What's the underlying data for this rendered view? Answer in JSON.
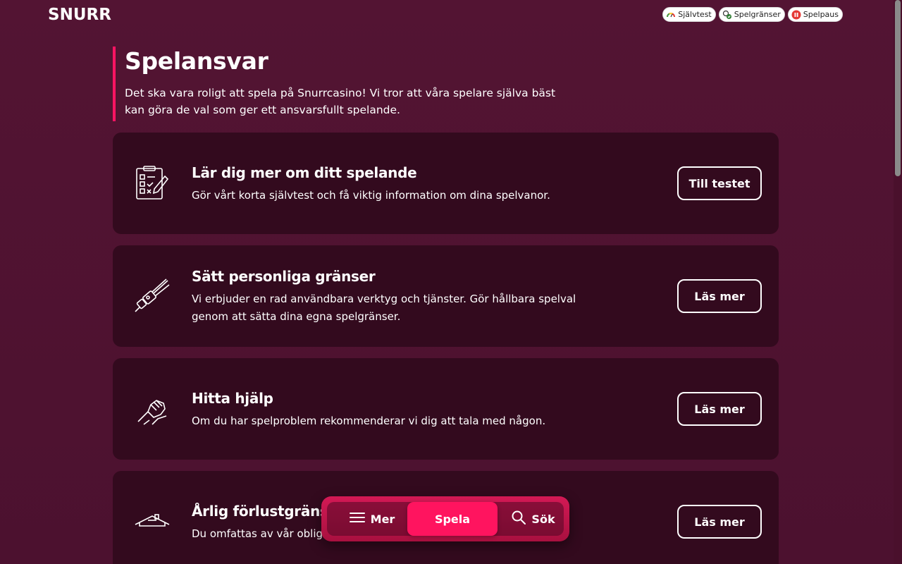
{
  "logo": {
    "text": "SNURR"
  },
  "topbar": {
    "pills": [
      {
        "label": "Självtest",
        "icon": "gauge-icon"
      },
      {
        "label": "Spelgränser",
        "icon": "limits-icon"
      },
      {
        "label": "Spelpaus",
        "icon": "pause-icon"
      }
    ]
  },
  "intro": {
    "title": "Spelansvar",
    "text": "Det ska vara roligt att spela på Snurrcasino! Vi tror att våra spelare själva bäst kan göra de val som ger ett ansvarsfullt spelande."
  },
  "cards": [
    {
      "title": "Lär dig mer om ditt spelande",
      "text": "Gör vårt korta självtest och få viktig information om dina spelvanor.",
      "button": "Till testet",
      "icon": "checklist-icon"
    },
    {
      "title": "Sätt personliga gränser",
      "text": "Vi erbjuder en rad användbara verktyg och tjänster. Gör hållbara spelval genom att sätta dina egna spelgränser.",
      "button": "Läs mer",
      "icon": "seatbelt-icon"
    },
    {
      "title": "Hitta hjälp",
      "text": "Om du har spelproblem rekommenderar vi dig att tala med någon.",
      "button": "Läs mer",
      "icon": "helping-hands-icon"
    },
    {
      "title": "Årlig förlustgräns",
      "text": "Du omfattas av vår obligatoriska",
      "button": "Läs mer",
      "icon": "house-icon"
    }
  ],
  "bottom_nav": {
    "mer": "Mer",
    "spela": "Spela",
    "sok": "Sök"
  },
  "colors": {
    "background": "#4f1230",
    "card": "#330a1e",
    "accent": "#ff145f"
  }
}
